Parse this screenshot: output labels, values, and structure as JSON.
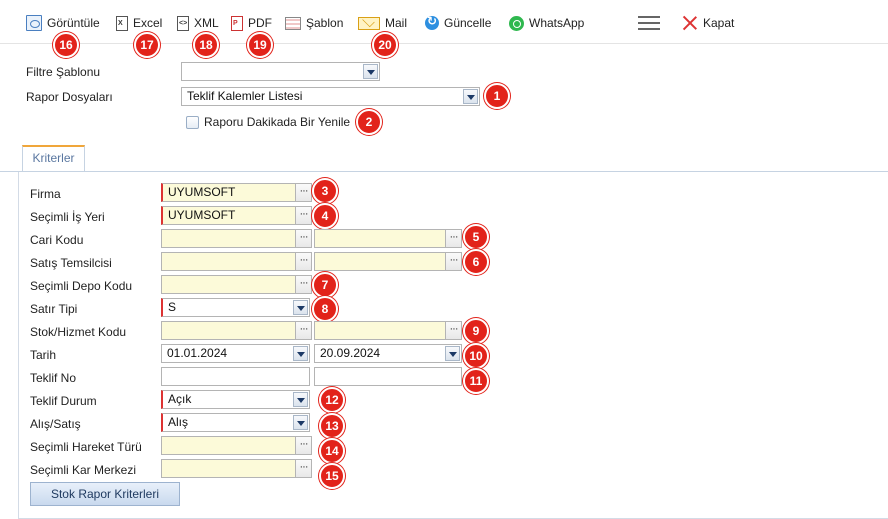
{
  "toolbar": {
    "items": [
      {
        "label": "Görüntüle"
      },
      {
        "label": "Excel"
      },
      {
        "label": "XML"
      },
      {
        "label": "PDF"
      },
      {
        "label": "Şablon"
      },
      {
        "label": "Mail"
      },
      {
        "label": "Güncelle"
      },
      {
        "label": "WhatsApp"
      },
      {
        "label": "Kapat"
      }
    ]
  },
  "top_form": {
    "filter_template_label": "Filtre Şablonu",
    "filter_template_value": "",
    "report_files_label": "Rapor Dosyaları",
    "report_files_value": "Teklif Kalemler Listesi",
    "auto_refresh_label": "Raporu Dakikada Bir Yenile"
  },
  "tab": {
    "label": "Kriterler"
  },
  "criteria": {
    "firma": {
      "label": "Firma",
      "value": "UYUMSOFT"
    },
    "isyeri": {
      "label": "Seçimli İş Yeri",
      "value": "UYUMSOFT"
    },
    "cari": {
      "label": "Cari Kodu",
      "from": "",
      "to": ""
    },
    "temsilci": {
      "label": "Satış Temsilcisi",
      "from": "",
      "to": ""
    },
    "depo": {
      "label": "Seçimli Depo Kodu",
      "value": ""
    },
    "satir_tipi": {
      "label": "Satır Tipi",
      "value": "S"
    },
    "stok": {
      "label": "Stok/Hizmet Kodu",
      "from": "",
      "to": ""
    },
    "tarih": {
      "label": "Tarih",
      "from": "01.01.2024",
      "to": "20.09.2024"
    },
    "teklif_no": {
      "label": "Teklif No",
      "from": "",
      "to": ""
    },
    "teklif_durum": {
      "label": "Teklif Durum",
      "value": "Açık"
    },
    "alis_satis": {
      "label": "Alış/Satış",
      "value": "Alış"
    },
    "hareket": {
      "label": "Seçimli Hareket Türü",
      "value": ""
    },
    "kar_merkezi": {
      "label": "Seçimli Kar Merkezi",
      "value": ""
    }
  },
  "stok_button": {
    "label": "Stok Rapor Kriterleri"
  },
  "badges": [
    "1",
    "2",
    "3",
    "4",
    "5",
    "6",
    "7",
    "8",
    "9",
    "10",
    "11",
    "12",
    "13",
    "14",
    "15",
    "16",
    "17",
    "18",
    "19",
    "20"
  ],
  "colors": {
    "badge": "#e2231a",
    "required": "#d33333",
    "lookup_bg": "#fcfad9",
    "tab_accent": "#f0a63a"
  }
}
